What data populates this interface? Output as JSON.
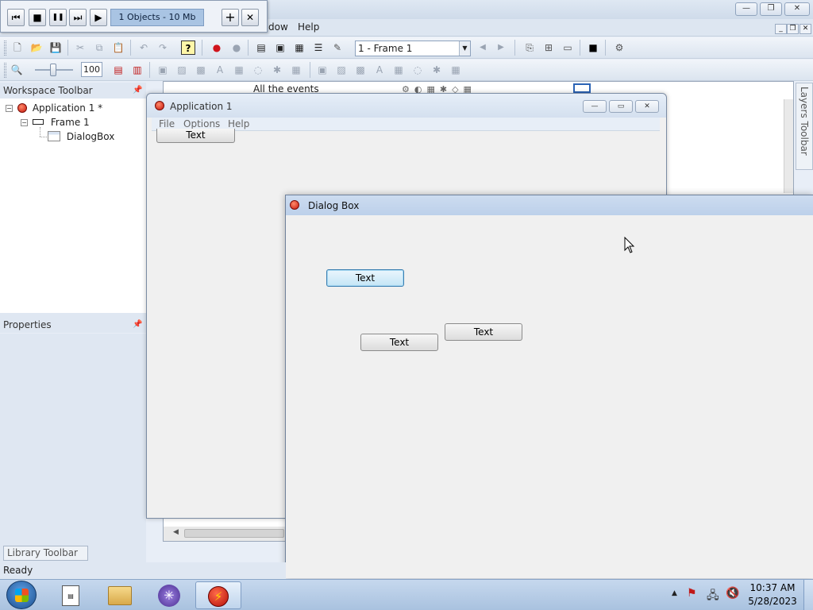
{
  "main_window": {
    "controls": {
      "minimize": "—",
      "maximize": "❐",
      "close": "✕"
    },
    "menu": {
      "window_partial": "dow",
      "help": "Help"
    },
    "mdi_controls": {
      "minimize": "_",
      "restore": "❐",
      "close": "✕"
    }
  },
  "player": {
    "status": "1 Objects - 10 Mb",
    "buttons": {
      "first": "⏮",
      "stop": "■",
      "pause": "❚❚",
      "next": "⏭",
      "play": "▶",
      "add": "+",
      "close": "✕"
    }
  },
  "toolbar1": {
    "frame_select": "1 - Frame 1",
    "help_icon": "?"
  },
  "toolbar2": {
    "zoom_value": "100"
  },
  "workspace": {
    "title": "Workspace Toolbar",
    "tree": [
      {
        "label": "Application 1 *",
        "toggle": "−"
      },
      {
        "label": "Frame 1",
        "toggle": "−"
      },
      {
        "label": "DialogBox"
      }
    ]
  },
  "properties": {
    "title": "Properties",
    "pin": "📌"
  },
  "editor": {
    "events_label": "All the events"
  },
  "layers": {
    "label": "Layers Toolbar"
  },
  "app_window": {
    "title": "Application 1",
    "menu": [
      "File",
      "Options",
      "Help"
    ],
    "button": "Text"
  },
  "dialog": {
    "title": "Dialog Box",
    "buttons": [
      "Text",
      "Text",
      "Text"
    ]
  },
  "library": {
    "label": "Library Toolbar"
  },
  "status": {
    "text": "Ready"
  },
  "taskbar": {
    "time": "10:37 AM",
    "date": "5/28/2023"
  }
}
